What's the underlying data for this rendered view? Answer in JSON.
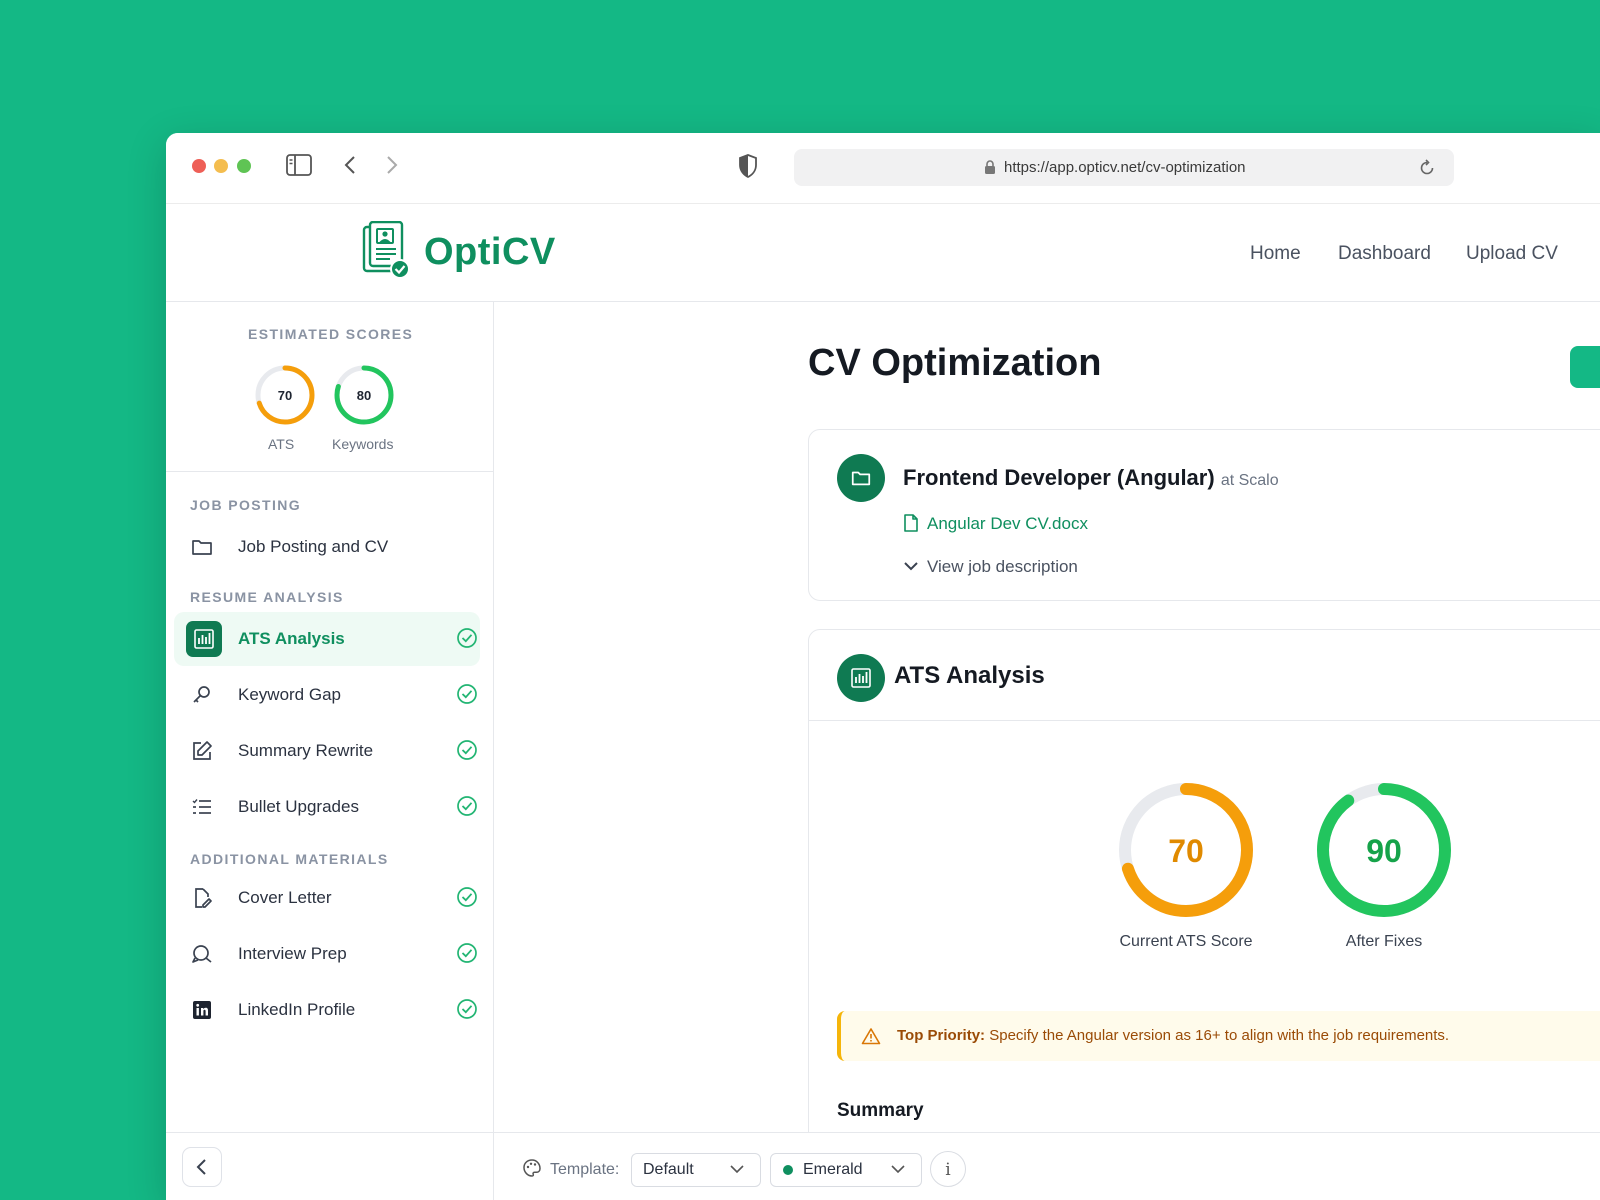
{
  "browser": {
    "url": "https://app.opticv.net/cv-optimization"
  },
  "brand": {
    "name": "OptiCV",
    "accent": "#0f8f5f",
    "background": "#14b885"
  },
  "nav": {
    "items": [
      "Home",
      "Dashboard",
      "Upload CV"
    ]
  },
  "sidebar": {
    "scores_heading": "ESTIMATED SCORES",
    "scores": [
      {
        "label": "ATS",
        "value": 70,
        "color": "#f59e0b"
      },
      {
        "label": "Keywords",
        "value": 80,
        "color": "#22c55e"
      }
    ],
    "sections": [
      {
        "heading": "JOB POSTING",
        "items": [
          {
            "label": "Job Posting and CV",
            "icon": "folder-icon",
            "checked": false
          }
        ]
      },
      {
        "heading": "RESUME ANALYSIS",
        "items": [
          {
            "label": "ATS Analysis",
            "icon": "bar-chart-icon",
            "checked": true,
            "active": true
          },
          {
            "label": "Keyword Gap",
            "icon": "key-icon",
            "checked": true
          },
          {
            "label": "Summary Rewrite",
            "icon": "edit-icon",
            "checked": true
          },
          {
            "label": "Bullet Upgrades",
            "icon": "list-icon",
            "checked": true
          }
        ]
      },
      {
        "heading": "ADDITIONAL MATERIALS",
        "items": [
          {
            "label": "Cover Letter",
            "icon": "document-edit-icon",
            "checked": true
          },
          {
            "label": "Interview Prep",
            "icon": "chat-icon",
            "checked": true
          },
          {
            "label": "LinkedIn Profile",
            "icon": "linkedin-icon",
            "checked": true
          }
        ]
      }
    ]
  },
  "main": {
    "title": "CV Optimization",
    "job": {
      "title": "Frontend Developer (Angular)",
      "company": "at Scalo",
      "file": "Angular Dev CV.docx",
      "toggle": "View job description"
    },
    "ats": {
      "title": "ATS Analysis",
      "current": {
        "value": 70,
        "label": "Current ATS Score",
        "color": "#f59e0b"
      },
      "after": {
        "value": 90,
        "label": "After Fixes",
        "color": "#22c55e"
      },
      "priority_label": "Top Priority:",
      "priority_text": "Specify the Angular version as 16+ to align with the job requirements.",
      "summary_heading": "Summary"
    }
  },
  "bottom": {
    "template_label": "Template:",
    "template_value": "Default",
    "theme_value": "Emerald",
    "theme_color": "#0f8f5f",
    "info_label": "i"
  }
}
